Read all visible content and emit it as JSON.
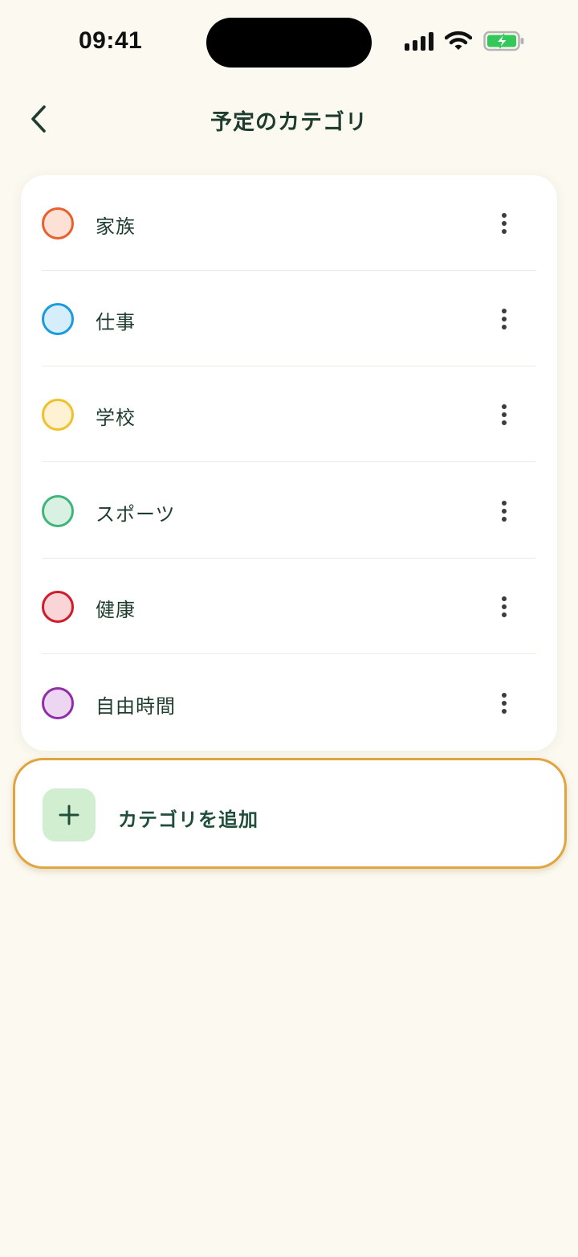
{
  "status_bar": {
    "time": "09:41",
    "icons": [
      "cellular-signal-icon",
      "wifi-icon",
      "battery-charging-icon"
    ],
    "battery_color": "#34c759"
  },
  "header": {
    "title": "予定のカテゴリ",
    "back_icon": "chevron-left-icon"
  },
  "categories": [
    {
      "label": "家族",
      "border_color": "#e8612c",
      "fill_color": "#fde0d6"
    },
    {
      "label": "仕事",
      "border_color": "#1a9be0",
      "fill_color": "#d6eefb"
    },
    {
      "label": "学校",
      "border_color": "#efc22d",
      "fill_color": "#fef2d3"
    },
    {
      "label": "スポーツ",
      "border_color": "#3fb57a",
      "fill_color": "#d8f1e3"
    },
    {
      "label": "健康",
      "border_color": "#d01c2a",
      "fill_color": "#f9d5d8"
    },
    {
      "label": "自由時間",
      "border_color": "#8f2ea8",
      "fill_color": "#ecd6f1"
    }
  ],
  "add_category": {
    "label": "カテゴリを追加",
    "icon": "plus-icon",
    "highlight_color": "#e1a43f"
  },
  "colors": {
    "background": "#fbf9f0",
    "text_primary": "#1f3d2f",
    "accent_green": "#1f4e3a"
  }
}
